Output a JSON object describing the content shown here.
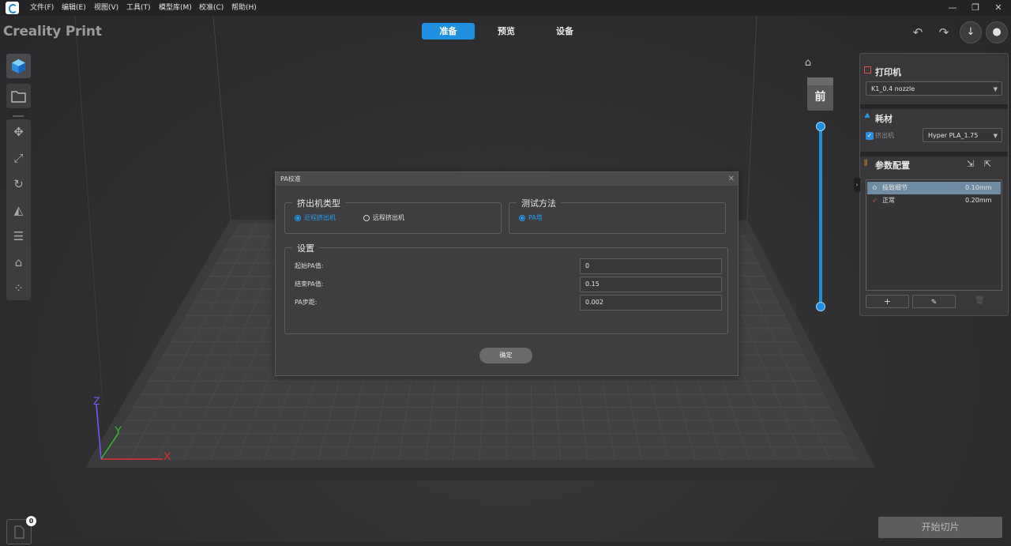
{
  "app": {
    "name": "Creality Print"
  },
  "menu": [
    "文件(F)",
    "编辑(E)",
    "视图(V)",
    "工具(T)",
    "模型库(M)",
    "校准(C)",
    "帮助(H)"
  ],
  "tabs": [
    {
      "label": "准备",
      "active": true
    },
    {
      "label": "预览",
      "active": false
    },
    {
      "label": "设备",
      "active": false
    }
  ],
  "view_cube": {
    "label": "前"
  },
  "dialog": {
    "title": "PA校准",
    "extruder_group": {
      "title": "挤出机类型",
      "options": [
        {
          "label": "近程挤出机",
          "selected": true
        },
        {
          "label": "远程挤出机",
          "selected": false
        }
      ]
    },
    "method_group": {
      "title": "测试方法",
      "options": [
        {
          "label": "PA塔",
          "selected": true
        }
      ]
    },
    "settings_group": {
      "title": "设置",
      "fields": [
        {
          "label": "起始PA值:",
          "value": "0"
        },
        {
          "label": "结束PA值:",
          "value": "0.15"
        },
        {
          "label": "PA步距:",
          "value": "0.002"
        }
      ]
    },
    "confirm": "确定"
  },
  "right_panel": {
    "printer": {
      "title": "打印机",
      "selected": "K1_0.4 nozzle"
    },
    "filament": {
      "title": "耗材",
      "extruder_label": "挤出机",
      "extruder_checked": true,
      "selected": "Hyper PLA_1.75"
    },
    "params": {
      "title": "参数配置",
      "profiles": [
        {
          "name": "极致细节",
          "layer": "0.10mm",
          "selected": true
        },
        {
          "name": "正常",
          "layer": "0.20mm",
          "selected": false
        }
      ]
    }
  },
  "axes": {
    "x": "X",
    "y": "Y",
    "z": "Z"
  },
  "notification_count": "0",
  "slice_button": "开始切片",
  "colors": {
    "accent": "#1e8fe1",
    "axis_x": "#e03030",
    "axis_y": "#30c030",
    "axis_z": "#6a5cff"
  }
}
